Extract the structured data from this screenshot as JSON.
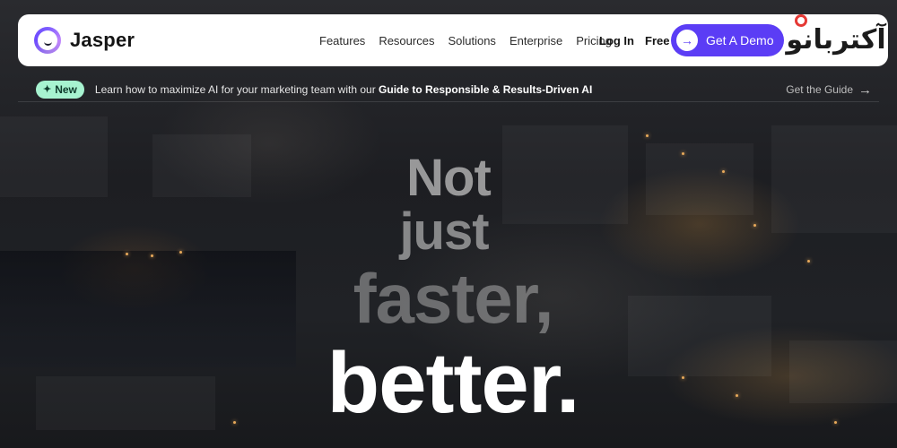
{
  "brand": {
    "name": "Jasper"
  },
  "nav": {
    "links": [
      "Features",
      "Resources",
      "Solutions",
      "Enterprise",
      "Pricing"
    ],
    "login": "Log In",
    "free_trial": "Free Trial",
    "demo": "Get A Demo"
  },
  "watermark": {
    "text": "آکتربانو"
  },
  "announcement": {
    "badge": "New",
    "text": "Learn how to maximize AI for your marketing team with our",
    "strong": "Guide to Responsible & Results-Driven AI",
    "cta": "Get the Guide"
  },
  "hero": {
    "line1": "Not",
    "line2": "just",
    "line3": "faster,",
    "line4": "better."
  },
  "colors": {
    "accent": "#5b3df5",
    "badge": "#a7f3d0",
    "background": "#15161a"
  }
}
